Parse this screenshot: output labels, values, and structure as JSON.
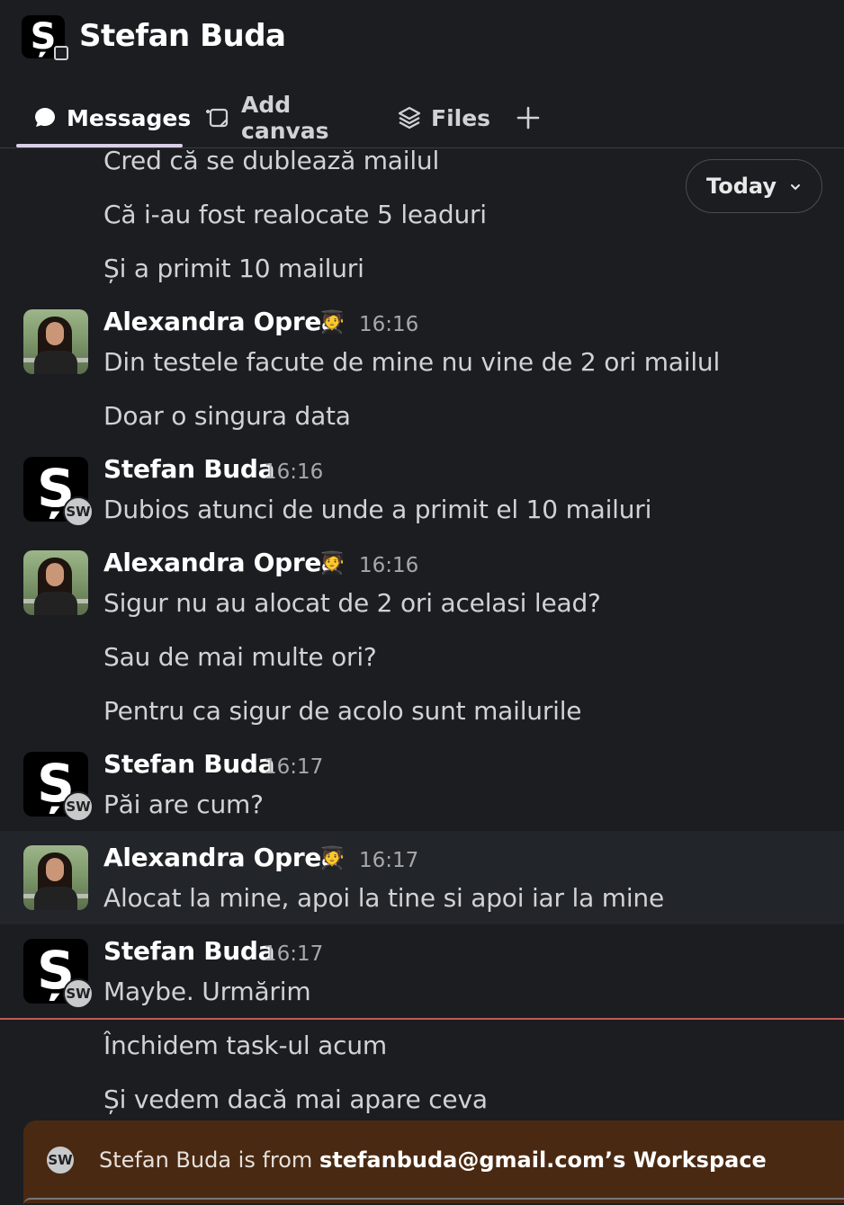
{
  "header": {
    "title": "Stefan Buda",
    "logo_letter": "Ș"
  },
  "tabs": [
    {
      "label": "Messages",
      "icon": "chat-bubble-icon",
      "active": true
    },
    {
      "label": "Add canvas",
      "icon": "canvas-icon",
      "active": false
    },
    {
      "label": "Files",
      "icon": "layers-icon",
      "active": false
    },
    {
      "label": "+",
      "icon": "plus-icon",
      "active": false
    }
  ],
  "date_pill": {
    "label": "Today",
    "icon": "chevron-down-icon"
  },
  "messages": {
    "pre": [
      "Cred că se dublează mailul",
      "Că i-au fost realocate 5 leaduri",
      "Și a primit 10 mailuri"
    ],
    "g1": {
      "name": "Alexandra Oprea",
      "emoji": "🧑‍🎓",
      "time": "16:16",
      "lines": [
        "Din testele facute de mine nu vine de 2 ori mailul",
        "Doar o singura data"
      ]
    },
    "g2": {
      "name": "Stefan Buda",
      "badge": "SW",
      "time": "16:16",
      "lines": [
        "Dubios atunci de unde a primit el 10 mailuri"
      ]
    },
    "g3": {
      "name": "Alexandra Oprea",
      "emoji": "🧑‍🎓",
      "time": "16:16",
      "lines": [
        "Sigur nu au alocat de 2 ori acelasi lead?",
        "Sau de mai multe ori?",
        "Pentru ca sigur de acolo sunt mailurile"
      ]
    },
    "g4": {
      "name": "Stefan Buda",
      "badge": "SW",
      "time": "16:17",
      "lines": [
        "Păi are cum?"
      ]
    },
    "g5": {
      "name": "Alexandra Oprea",
      "emoji": "🧑‍🎓",
      "time": "16:17",
      "lines": [
        "Alocat la mine, apoi la tine si apoi iar la mine"
      ]
    },
    "g6": {
      "name": "Stefan Buda",
      "badge": "SW",
      "time": "16:17",
      "lines": [
        "Maybe. Urmărim",
        "Închidem task-ul acum",
        "Și vedem dacă mai apare ceva"
      ]
    }
  },
  "banner": {
    "badge": "SW",
    "text_prefix": "Stefan Buda is from ",
    "text_bold": "stefanbuda@gmail.com’s Workspace"
  },
  "colors": {
    "background": "#1b1d21",
    "new_message_line": "#c15b52",
    "banner_bg": "#4a2912"
  }
}
